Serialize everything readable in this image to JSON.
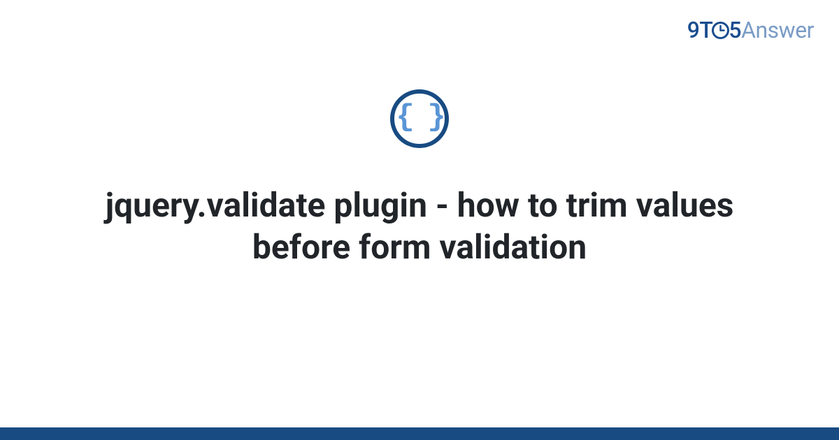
{
  "brand": {
    "part1": "9T",
    "part2": "5",
    "part3": "Answer"
  },
  "category_icon": {
    "name": "code-braces",
    "glyph": "{ }"
  },
  "title": "jquery.validate plugin - how to trim values before form validation",
  "colors": {
    "primary": "#184b82",
    "accent": "#5a95d6",
    "logo_light": "#7a9cc6",
    "text": "#212529"
  }
}
